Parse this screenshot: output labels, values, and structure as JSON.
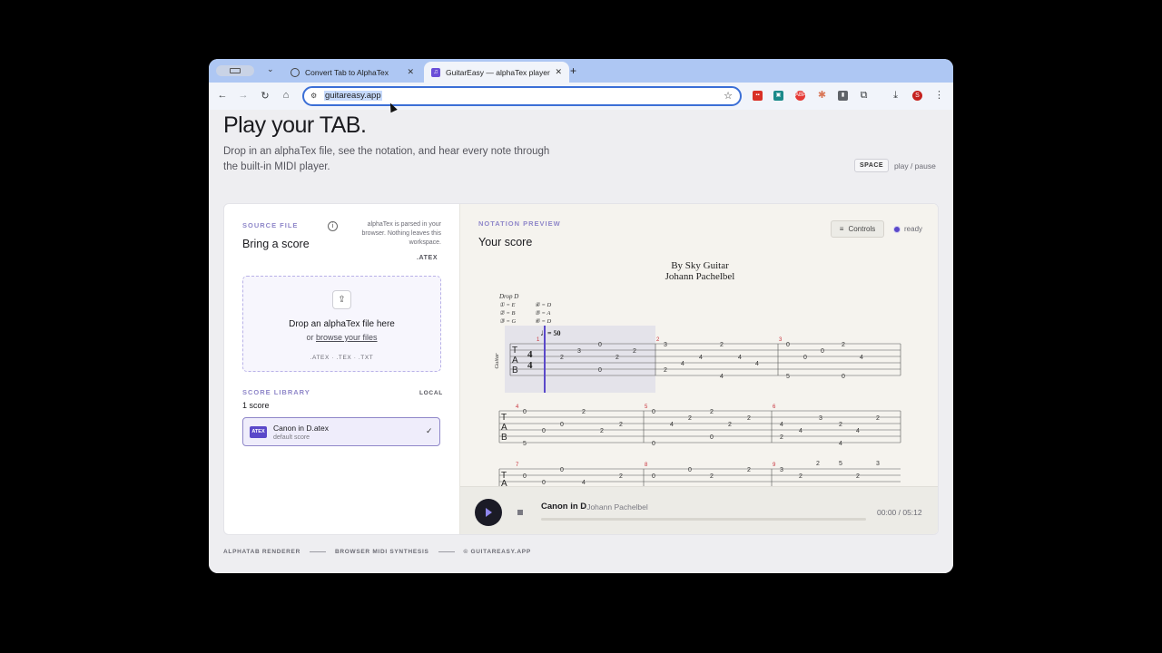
{
  "browser": {
    "tabs": [
      {
        "title": "Convert Tab to AlphaTex",
        "favicon": "openai-icon",
        "active": false
      },
      {
        "title": "GuitarEasy — alphaTex player",
        "favicon": "guitareasy-icon",
        "active": true
      }
    ],
    "url": "guitareasy.app",
    "extensions": [
      {
        "name": "red-extension-icon",
        "color": "#d93025"
      },
      {
        "name": "teal-extension-icon",
        "color": "#1b8a8a"
      },
      {
        "name": "abp-icon",
        "label": "ABP",
        "color": "#e53935"
      },
      {
        "name": "claude-icon",
        "color": "#d97757"
      },
      {
        "name": "gray-extension-icon",
        "color": "#5f6368"
      }
    ],
    "profile_initial": "S"
  },
  "hero": {
    "title": "Play your TAB.",
    "subtitle": "Drop in an alphaTex file, see the notation, and hear every note through the built-in MIDI player.",
    "shortcut_key": "SPACE",
    "shortcut_label": "play / pause"
  },
  "source": {
    "eyebrow": "SOURCE FILE",
    "title": "Bring a score",
    "privacy_note": "alphaTex is parsed in your browser. Nothing leaves this workspace.",
    "format": ".ATEX",
    "dropzone": {
      "title": "Drop an alphaTex file here",
      "or_text": "or",
      "browse_link": "browse your files",
      "types": ".ATEX · .TEX · .TXT"
    }
  },
  "library": {
    "eyebrow": "SCORE LIBRARY",
    "scope": "LOCAL",
    "count": "1 score",
    "items": [
      {
        "badge": "ATEX",
        "name": "Canon in D.atex",
        "subtitle": "default score",
        "selected": true
      }
    ]
  },
  "preview": {
    "eyebrow": "NOTATION PREVIEW",
    "title": "Your score",
    "controls_label": "Controls",
    "status": "ready",
    "sheet": {
      "credit": "By Sky Guitar",
      "composer": "Johann Pachelbel",
      "tuning_name": "Drop D",
      "tuning": [
        "① = E",
        "② = B",
        "③ = G",
        "④ = D",
        "⑤ = A",
        "⑥ = D"
      ],
      "instrument": "Guitar",
      "tempo": "= 50",
      "time_signature": [
        "4",
        "4"
      ],
      "tab_label": [
        "T",
        "A",
        "B"
      ],
      "bar_numbers": [
        "1",
        "2",
        "3",
        "4",
        "5",
        "6",
        "7",
        "8",
        "9"
      ]
    }
  },
  "player": {
    "title": "Canon in D",
    "artist": "· Johann Pachelbel",
    "time": "00:00 / 05:12",
    "progress": 0
  },
  "footer": [
    "ALPHATAB RENDERER",
    "BROWSER MIDI SYNTHESIS",
    "© GUITAREASY.APP"
  ]
}
